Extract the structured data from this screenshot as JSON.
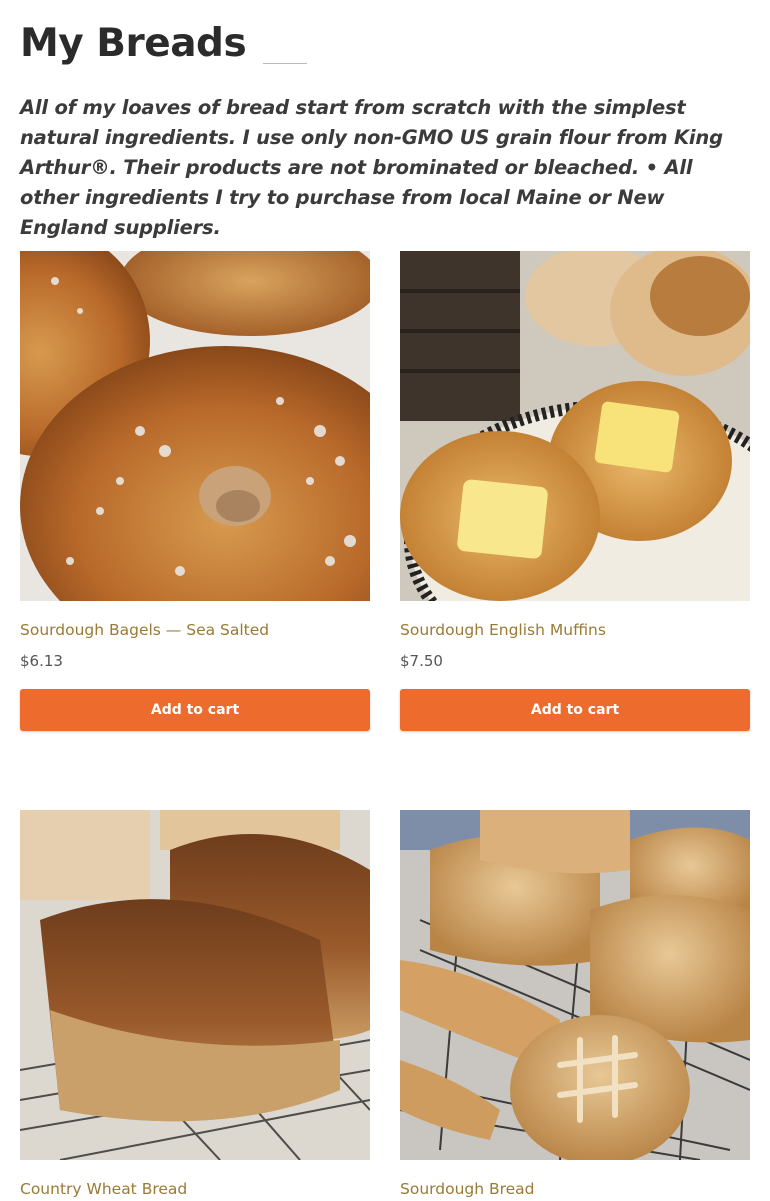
{
  "page": {
    "title": "My Breads",
    "intro": "All of my loaves of bread start from scratch with the simplest natural ingredients. I use only non-GMO US grain flour from King Arthur®. Their products are not brominated or bleached. • All other ingredients I try to purchase from local Maine or New England suppliers."
  },
  "products": [
    {
      "name": "Sourdough Bagels — Sea Salted",
      "price": "$6.13",
      "button": "Add to cart"
    },
    {
      "name": "Sourdough English Muffins",
      "price": "$7.50",
      "button": "Add to cart"
    },
    {
      "name": "Country Wheat Bread",
      "price": "",
      "button": ""
    },
    {
      "name": "Sourdough Bread",
      "price": "",
      "button": ""
    }
  ],
  "colors": {
    "accent_button": "#ed6b2c",
    "product_link": "#9a7a35",
    "heading": "#2b2b2b"
  }
}
